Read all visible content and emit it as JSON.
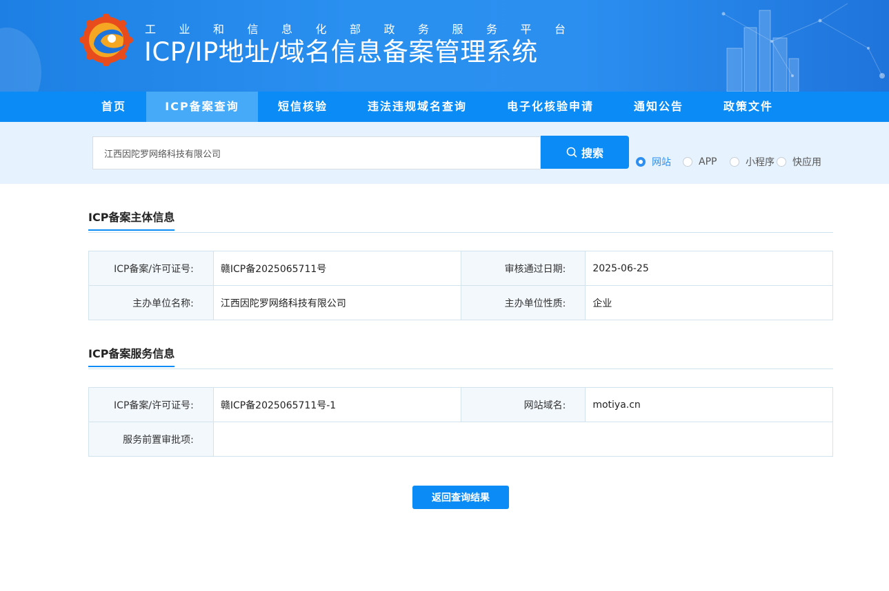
{
  "header": {
    "subtitle": "工业和信息化部政务服务平台",
    "title": "ICP/IP地址/域名信息备案管理系统"
  },
  "nav": {
    "items": [
      {
        "label": "首页"
      },
      {
        "label": "ICP备案查询"
      },
      {
        "label": "短信核验"
      },
      {
        "label": "违法违规域名查询"
      },
      {
        "label": "电子化核验申请"
      },
      {
        "label": "通知公告"
      },
      {
        "label": "政策文件"
      }
    ],
    "active": "ICP备案查询"
  },
  "search": {
    "value": "江西因陀罗网络科技有限公司",
    "button_label": "搜索",
    "icon": "search-icon",
    "types": [
      {
        "label": "网站",
        "checked": true
      },
      {
        "label": "APP",
        "checked": false
      },
      {
        "label": "小程序",
        "checked": false
      },
      {
        "label": "快应用",
        "checked": false
      }
    ]
  },
  "subject_section": {
    "title": "ICP备案主体信息",
    "license_label": "ICP备案/许可证号:",
    "license_value": "赣ICP备2025065711号",
    "approve_date_label": "审核通过日期:",
    "approve_date_value": "2025-06-25",
    "org_name_label": "主办单位名称:",
    "org_name_value": "江西因陀罗网络科技有限公司",
    "org_type_label": "主办单位性质:",
    "org_type_value": "企业"
  },
  "service_section": {
    "title": "ICP备案服务信息",
    "license_label": "ICP备案/许可证号:",
    "license_value": "赣ICP备2025065711号-1",
    "domain_label": "网站域名:",
    "domain_value": "motiya.cn",
    "pre_approval_label": "服务前置审批项:",
    "pre_approval_value": ""
  },
  "actions": {
    "back_label": "返回查询结果"
  },
  "colors": {
    "primary": "#0a8bf5",
    "nav_active": "#47aaf8",
    "search_band": "#e6f2fd",
    "label_bg": "#f3f8fc"
  }
}
